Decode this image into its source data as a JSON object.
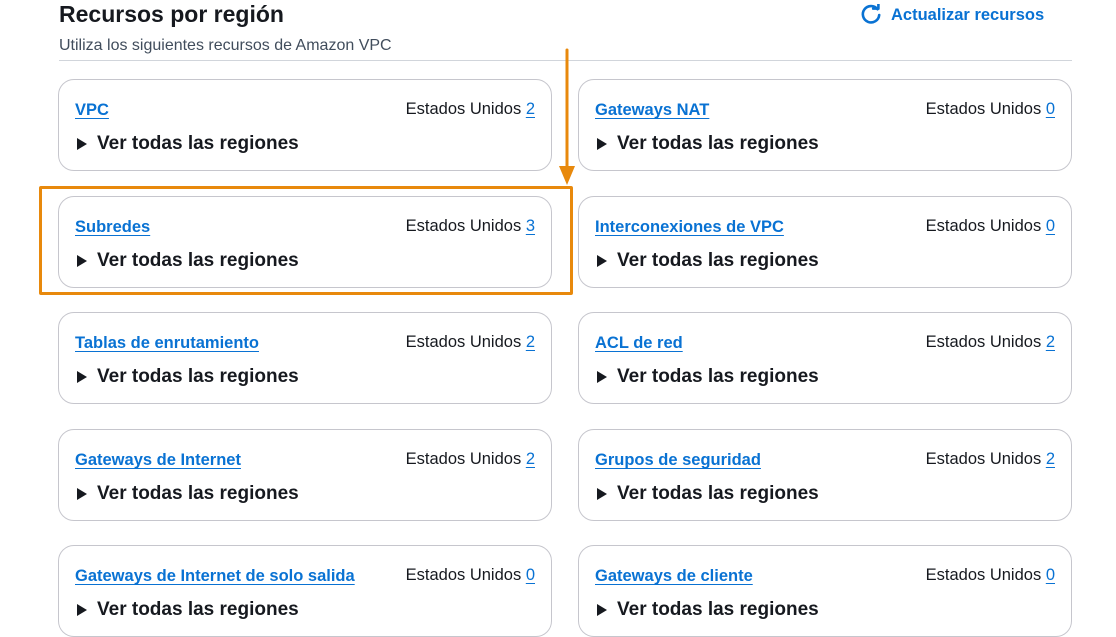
{
  "header": {
    "title": "Recursos por región",
    "subtitle": "Utiliza los siguientes recursos de Amazon VPC",
    "refresh_label": "Actualizar recursos"
  },
  "resources": [
    {
      "name": "VPC",
      "region": "Estados Unidos",
      "count": "2",
      "expand_label": "Ver todas las regiones"
    },
    {
      "name": "Gateways NAT",
      "region": "Estados Unidos",
      "count": "0",
      "expand_label": "Ver todas las regiones"
    },
    {
      "name": "Subredes",
      "region": "Estados Unidos",
      "count": "3",
      "expand_label": "Ver todas las regiones"
    },
    {
      "name": "Interconexiones de VPC",
      "region": "Estados Unidos",
      "count": "0",
      "expand_label": "Ver todas las regiones"
    },
    {
      "name": "Tablas de enrutamiento",
      "region": "Estados Unidos",
      "count": "2",
      "expand_label": "Ver todas las regiones"
    },
    {
      "name": "ACL de red",
      "region": "Estados Unidos",
      "count": "2",
      "expand_label": "Ver todas las regiones"
    },
    {
      "name": "Gateways de Internet",
      "region": "Estados Unidos",
      "count": "2",
      "expand_label": "Ver todas las regiones"
    },
    {
      "name": "Grupos de seguridad",
      "region": "Estados Unidos",
      "count": "2",
      "expand_label": "Ver todas las regiones"
    },
    {
      "name": "Gateways de Internet de solo salida",
      "region": "Estados Unidos",
      "count": "0",
      "expand_label": "Ver todas las regiones"
    },
    {
      "name": "Gateways de cliente",
      "region": "Estados Unidos",
      "count": "0",
      "expand_label": "Ver todas las regiones"
    }
  ],
  "colors": {
    "link": "#0972d3",
    "text": "#16191f",
    "annotation": "#e8890c",
    "card_border": "#c6c6cd"
  },
  "icons": {
    "refresh": "refresh-icon",
    "expand": "caret-right-icon"
  }
}
